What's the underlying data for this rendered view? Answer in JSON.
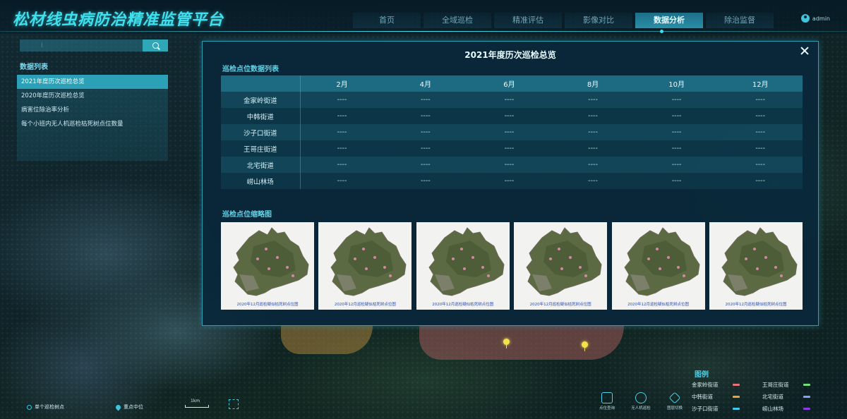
{
  "app": {
    "title": "松材线虫病防治精准监管平台",
    "user": "admin"
  },
  "nav": {
    "items": [
      {
        "label": "首页",
        "active": false
      },
      {
        "label": "全域巡检",
        "active": false
      },
      {
        "label": "精准评估",
        "active": false
      },
      {
        "label": "影像对比",
        "active": false
      },
      {
        "label": "数据分析",
        "active": true
      },
      {
        "label": "除治监督",
        "active": false
      }
    ]
  },
  "sidebar": {
    "search": {
      "value": "",
      "placeholder": "I"
    },
    "title": "数据列表",
    "items": [
      {
        "label": "2021年度历次巡检总览",
        "active": true
      },
      {
        "label": "2020年度历次巡检总览",
        "active": false
      },
      {
        "label": "病害位除治率分析",
        "active": false
      },
      {
        "label": "每个小班内无人机巡检枯死树点位数量",
        "active": false
      }
    ]
  },
  "modal": {
    "title": "2021年度历次巡检总览",
    "table_section_title": "巡检点位数据列表",
    "months": [
      "2月",
      "4月",
      "6月",
      "8月",
      "10月",
      "12月"
    ],
    "rows": [
      {
        "name": "金家岭街道",
        "values": [
          "----",
          "----",
          "----",
          "----",
          "----",
          "----"
        ]
      },
      {
        "name": "中韩街道",
        "values": [
          "----",
          "----",
          "----",
          "----",
          "----",
          "----"
        ]
      },
      {
        "name": "沙子口街道",
        "values": [
          "----",
          "----",
          "----",
          "----",
          "----",
          "----"
        ]
      },
      {
        "name": "王哥庄街道",
        "values": [
          "----",
          "----",
          "----",
          "----",
          "----",
          "----"
        ]
      },
      {
        "name": "北宅街道",
        "values": [
          "----",
          "----",
          "----",
          "----",
          "----",
          "----"
        ]
      },
      {
        "name": "崂山林场",
        "values": [
          "----",
          "----",
          "----",
          "----",
          "----",
          "----"
        ]
      }
    ],
    "thumb_section_title": "巡检点位缩略图",
    "thumbnails": [
      {
        "caption": "2020年12月巡检疑似枯死树点位图"
      },
      {
        "caption": "2020年12月巡检疑似枯死树点位图"
      },
      {
        "caption": "2020年12月巡检疑似枯死树点位图"
      },
      {
        "caption": "2020年12月巡检疑似枯死树点位图"
      },
      {
        "caption": "2020年12月巡检疑似枯死树点位图"
      },
      {
        "caption": "2020年12月巡检疑似枯死树点位图"
      }
    ]
  },
  "legend": {
    "title": "图例",
    "items": [
      {
        "label": "金家岭街道",
        "color": "#e8737a"
      },
      {
        "label": "王哥庄街道",
        "color": "#6fe07a"
      },
      {
        "label": "中韩街道",
        "color": "#f0a23a"
      },
      {
        "label": "北宅街道",
        "color": "#7aa8f0"
      },
      {
        "label": "沙子口街道",
        "color": "#3fc8f0"
      },
      {
        "label": "崂山林场",
        "color": "#8a3ae8"
      }
    ]
  },
  "bottom_bar": {
    "point_toggle": "单个巡检树点",
    "locate": "重点中位",
    "scale": "1km"
  },
  "tools": [
    {
      "label": "点位查询",
      "icon": "target-icon"
    },
    {
      "label": "无人机巡检",
      "icon": "drone-icon"
    },
    {
      "label": "图层切换",
      "icon": "layers-icon"
    }
  ]
}
